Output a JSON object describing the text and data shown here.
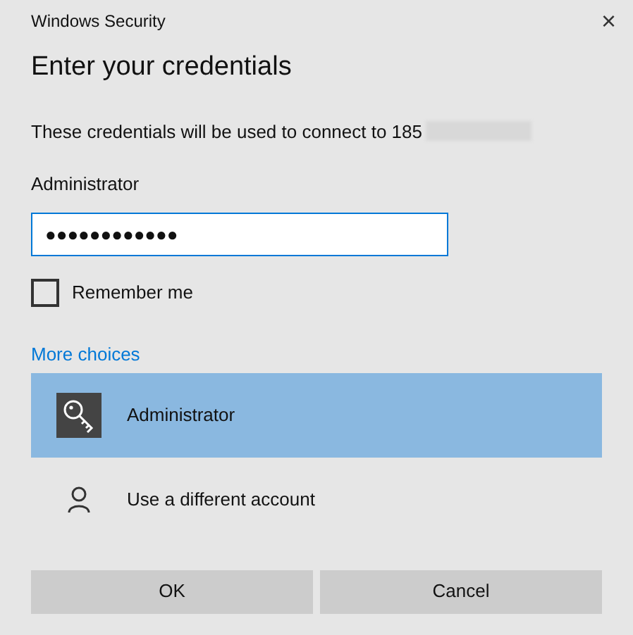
{
  "window": {
    "title": "Windows Security",
    "close": "×"
  },
  "heading": "Enter your credentials",
  "message": "These credentials will be used to connect to 185",
  "username": "Administrator",
  "password": {
    "value": "●●●●●●●●●●●●"
  },
  "remember": {
    "label": "Remember me",
    "checked": false
  },
  "more_choices": "More choices",
  "accounts": [
    {
      "kind": "key",
      "label": "Administrator",
      "selected": true
    },
    {
      "kind": "person",
      "label": "Use a different account",
      "selected": false
    }
  ],
  "buttons": [
    "OK",
    "Cancel"
  ]
}
